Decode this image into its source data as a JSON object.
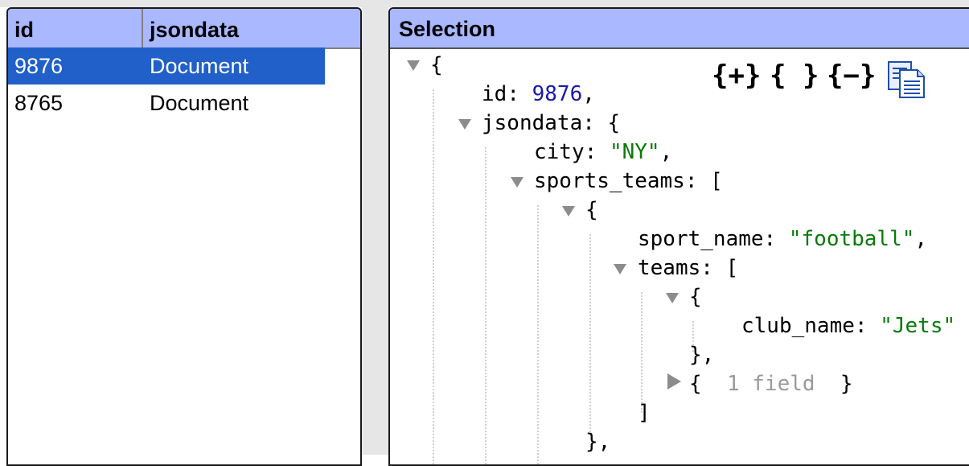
{
  "table": {
    "columns": [
      "id",
      "jsondata"
    ],
    "rows": [
      {
        "id": "9876",
        "jsondata": "Document",
        "selected": true
      },
      {
        "id": "8765",
        "jsondata": "Document",
        "selected": false
      }
    ]
  },
  "selection": {
    "title": "Selection",
    "toolbar": {
      "expand_all": "{+}",
      "braces": "{ }",
      "collapse_all": "{−}",
      "copy_icon": "copy-document-icon"
    },
    "tree": {
      "open_brace": "{",
      "id_key": "id",
      "id_value": "9876",
      "jsondata_key": "jsondata",
      "city_key": "city",
      "city_value": "\"NY\"",
      "sports_teams_key": "sports_teams",
      "sport_name_key": "sport_name",
      "sport_name_value": "\"football\"",
      "teams_key": "teams",
      "club_name_key": "club_name",
      "club_name_value": "\"Jets\"",
      "collapsed_summary": "1 field"
    }
  },
  "colors": {
    "header_bg": "#a9b8ff",
    "selected_row_bg": "#2060c8",
    "number": "#1a1aa6",
    "string": "#0a7a0a"
  }
}
